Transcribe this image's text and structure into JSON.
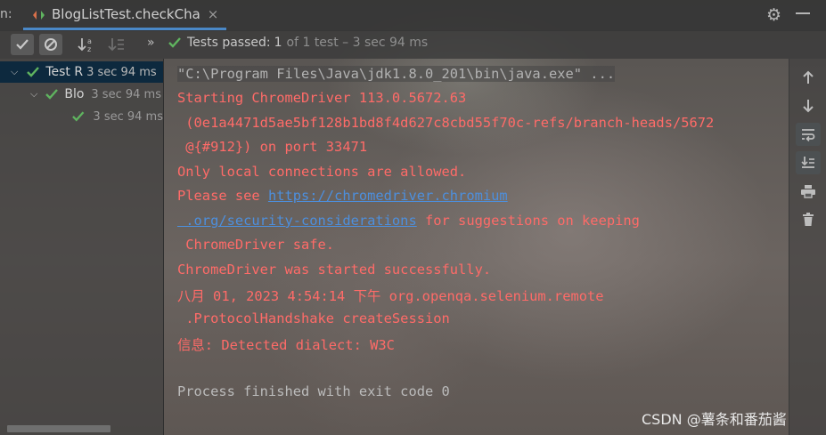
{
  "header": {
    "run_label": "n:",
    "tab_title": "BlogListTest.checkCha",
    "close_glyph": "×"
  },
  "toolbar": {
    "status_prefix": "Tests passed:",
    "passed_count": "1",
    "status_suffix": "of 1 test – 3 sec 94 ms"
  },
  "tree": {
    "items": [
      {
        "label": "Test R",
        "time": "3 sec 94 ms"
      },
      {
        "label": "Blo",
        "time": "3 sec 94 ms"
      },
      {
        "label": "",
        "time": "3 sec 94 ms"
      }
    ]
  },
  "console": {
    "lines": [
      "\"C:\\Program Files\\Java\\jdk1.8.0_201\\bin\\java.exe\" ...",
      "Starting ChromeDriver 113.0.5672.63",
      " (0e1a4471d5ae5bf128b1bd8f4d627c8cbd55f70c-refs/branch-heads/5672",
      " @{#912}) on port 33471",
      "Only local connections are allowed.",
      "Please see ",
      "https://chromedriver.chromium",
      " .org/security-considerations",
      " for suggestions on keeping",
      " ChromeDriver safe.",
      "ChromeDriver was started successfully.",
      "八月 01, 2023 4:54:14 下午 org.openqa.selenium.remote",
      " .ProtocolHandshake createSession",
      "信息: Detected dialect: W3C",
      "Process finished with exit code 0"
    ]
  },
  "watermark": "CSDN @薯条和番茄酱",
  "colors": {
    "error_text": "#ff6b68",
    "link": "#4d8fdd",
    "pass_green": "#5fb35f",
    "selection": "#0d293e",
    "tab_underline": "#4a88c7"
  }
}
